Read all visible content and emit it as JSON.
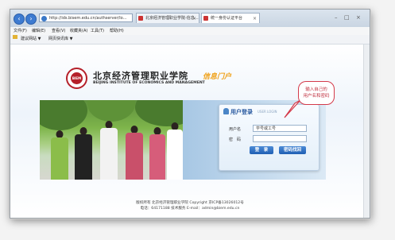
{
  "browser": {
    "address_url": "http://ids.bisem.edu.cn/authserver/lo...",
    "tabs": [
      {
        "label": "北京经济管理职业学院-信息…"
      },
      {
        "label": "统一身份认证平台"
      }
    ],
    "window_controls": {
      "minimize": "–",
      "maximize": "□",
      "close": "×"
    },
    "menu": [
      "文件(F)",
      "编辑(E)",
      "查看(V)",
      "收藏夹(A)",
      "工具(T)",
      "帮助(H)"
    ],
    "favorites": {
      "label": "建议网站 ▼",
      "item": "网页快讯库 ▼"
    }
  },
  "site": {
    "logo_text": "BIEM",
    "school_name_cn": "北京经济管理职业学院",
    "school_name_en": "BEIJING INSTITUTE OF ECONOMICS AND MANAGEMENT",
    "portal_label": "信息门户"
  },
  "login": {
    "title": "用户登录",
    "subtitle": "USER LOGIN",
    "username_label": "用户名",
    "username_value": "学号或工号",
    "password_label": "密　码",
    "password_value": "",
    "login_button": "登　录",
    "forgot_button": "密码找回"
  },
  "callout": {
    "line1": "输入自己的",
    "line2": "用户名和密码"
  },
  "footer": {
    "line1": "版权所有 北京经济管理职业学院 Copyright 京ICP备13026012号",
    "line2": "电话：64171188  技术服务 E-mail：admin@biem.edu.cn"
  }
}
